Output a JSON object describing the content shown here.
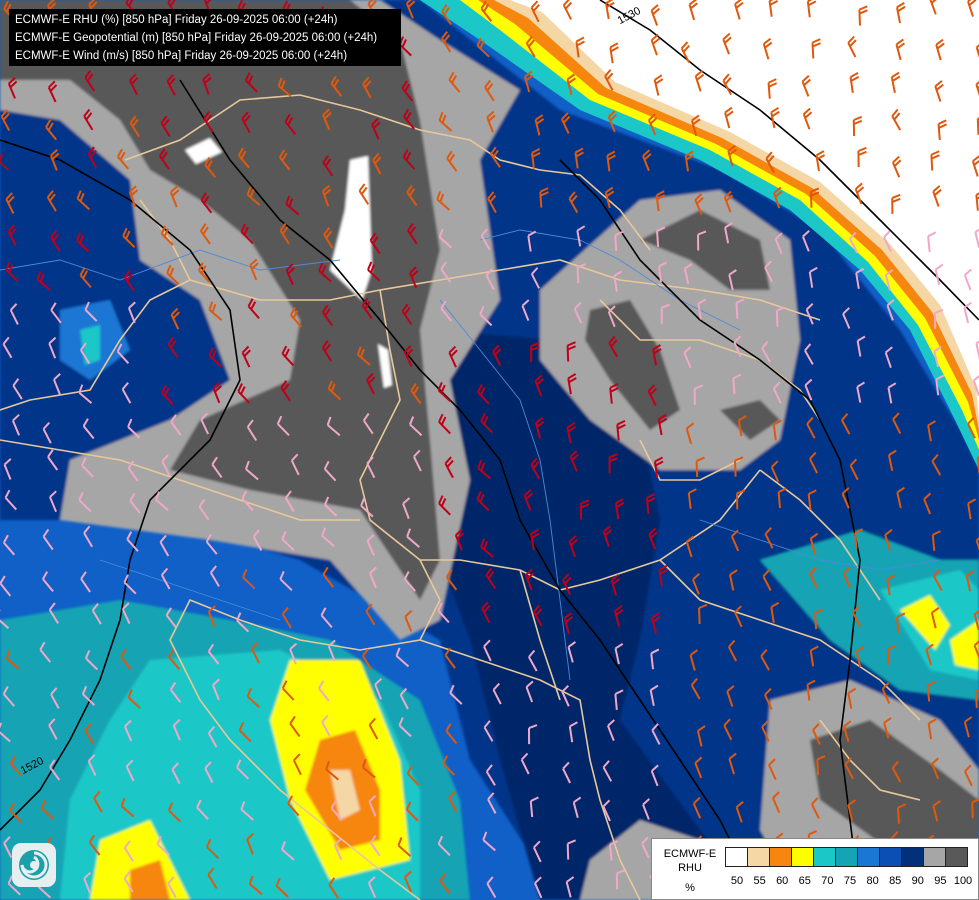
{
  "header": {
    "lines": [
      "ECMWF-E RHU (%) [850 hPa] Friday 26-09-2025 06:00 (+24h)",
      "ECMWF-E Geopotential (m) [850 hPa] Friday 26-09-2025 06:00 (+24h)",
      "ECMWF-E Wind (m/s) [850 hPa] Friday 26-09-2025 06:00 (+24h)"
    ]
  },
  "contour_labels": [
    "1530",
    "1520"
  ],
  "legend": {
    "title": "ECMWF-E",
    "subtitle": "RHU",
    "unit": "%",
    "ticks": [
      "50",
      "55",
      "60",
      "65",
      "70",
      "75",
      "80",
      "85",
      "90",
      "95",
      "100"
    ],
    "colors": [
      "#ffffff",
      "#f5d7a6",
      "#f6860e",
      "#ffff00",
      "#1cc7c7",
      "#14a4b4",
      "#1a77d4",
      "#0c4fb4",
      "#03307a",
      "#a6a6a6",
      "#595959"
    ]
  },
  "logo": {
    "icon": "ecmwf-spiral-logo-icon"
  }
}
